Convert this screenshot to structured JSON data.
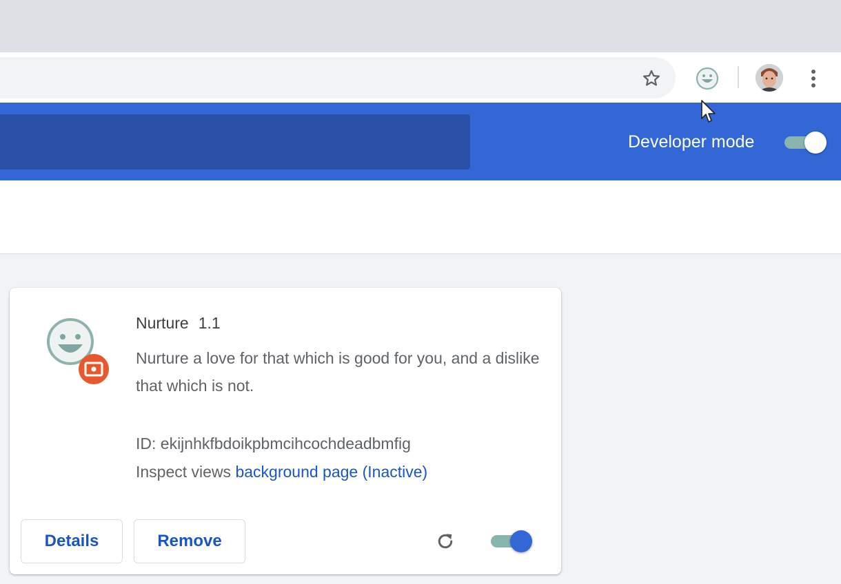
{
  "toolbar": {
    "bookmark_icon": "star-outline-icon",
    "extension_icon": "smiley-face-icon",
    "menu_icon": "three-dot-menu-icon"
  },
  "header": {
    "developer_mode_label": "Developer mode",
    "developer_mode_on": true,
    "accent": "#3367d6"
  },
  "extension": {
    "name": "Nurture",
    "version": "1.1",
    "description": "Nurture a love for that which is good for you, and a dislike that which is not.",
    "id_label": "ID: ekijnhkfbdoikpbmcihcochdeadbmfig",
    "inspect_label": "Inspect views",
    "inspect_link": "background page (Inactive)",
    "details_label": "Details",
    "remove_label": "Remove",
    "enabled": true,
    "badge_color": "#e8582f"
  }
}
